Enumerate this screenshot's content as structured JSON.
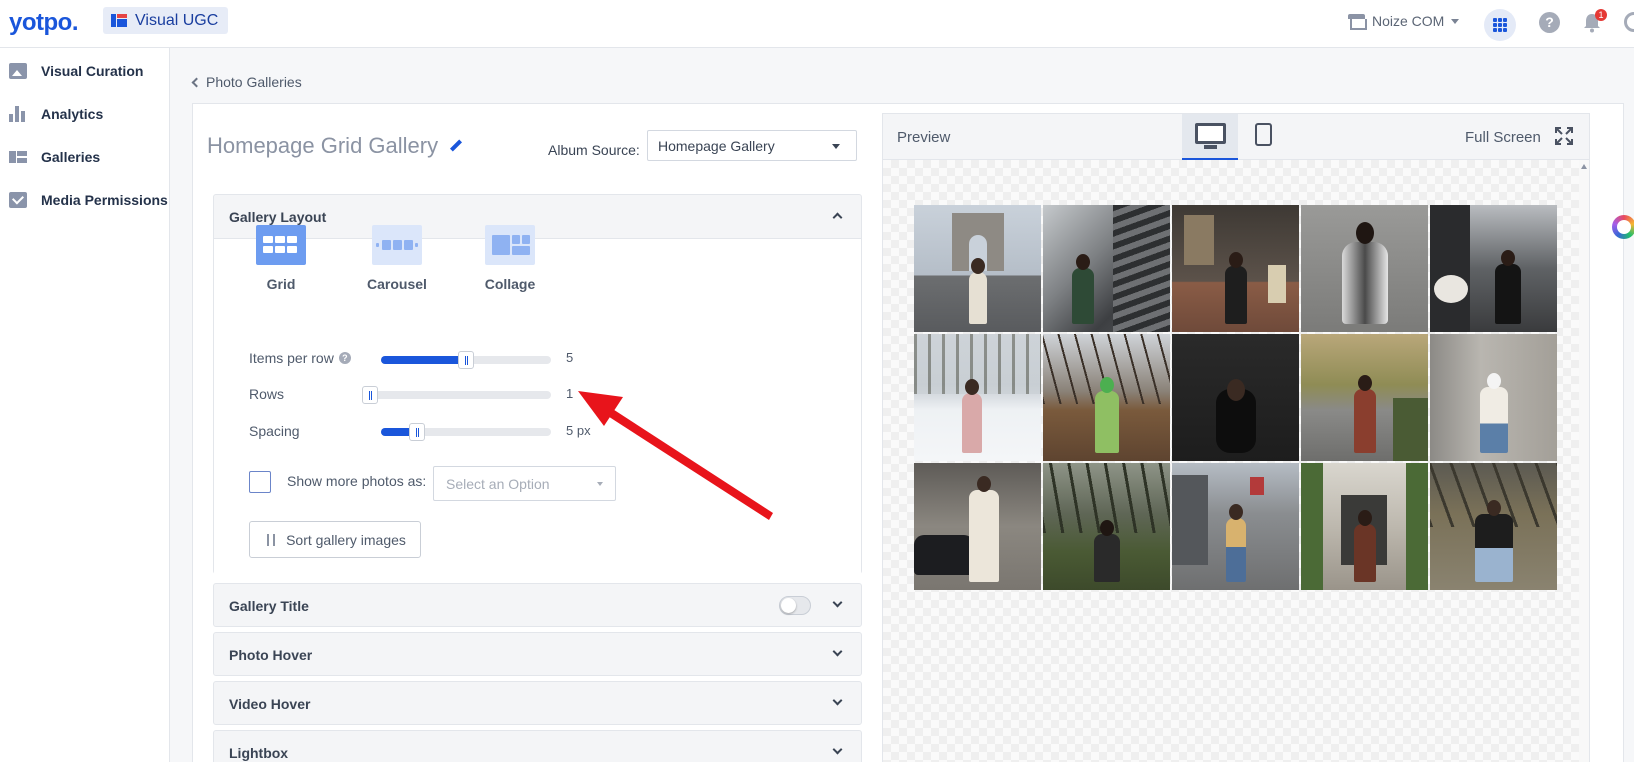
{
  "topbar": {
    "logo": "yotpo.",
    "product": "Visual UGC",
    "store": "Noize COM",
    "notification_count": "1",
    "help": "?"
  },
  "sidebar": {
    "items": [
      {
        "label": "Visual Curation",
        "icon": "photo-icon"
      },
      {
        "label": "Analytics",
        "icon": "bar-chart-icon"
      },
      {
        "label": "Galleries",
        "icon": "gallery-icon"
      },
      {
        "label": "Media Permissions",
        "icon": "checkmark-icon"
      }
    ]
  },
  "breadcrumb": {
    "back_label": "Photo Galleries"
  },
  "editor": {
    "gallery_title": "Homepage Grid Gallery",
    "album_source_label": "Album Source:",
    "album_source_value": "Homepage Gallery"
  },
  "layout_panel": {
    "title": "Gallery Layout",
    "options": [
      {
        "label": "Grid",
        "selected": true
      },
      {
        "label": "Carousel",
        "selected": false
      },
      {
        "label": "Collage",
        "selected": false
      }
    ],
    "sliders": [
      {
        "label": "Items per row",
        "value": "5",
        "level": 0.5
      },
      {
        "label": "Rows",
        "value": "1",
        "level": 0.0
      },
      {
        "label": "Spacing",
        "value": "5 px",
        "level": 0.18
      }
    ],
    "show_more_label": "Show more photos as:",
    "show_more_placeholder": "Select an Option",
    "sort_button": "Sort gallery images"
  },
  "sections": [
    {
      "title": "Gallery Title",
      "toggle": false
    },
    {
      "title": "Photo Hover"
    },
    {
      "title": "Video Hover"
    },
    {
      "title": "Lightbox"
    }
  ],
  "preview": {
    "label": "Preview",
    "fullscreen_label": "Full Screen",
    "devices": [
      "desktop-icon",
      "tablet-icon"
    ],
    "active_device": "desktop"
  },
  "colors": {
    "brand": "#1a56db",
    "annotation_arrow": "#e8141b"
  }
}
